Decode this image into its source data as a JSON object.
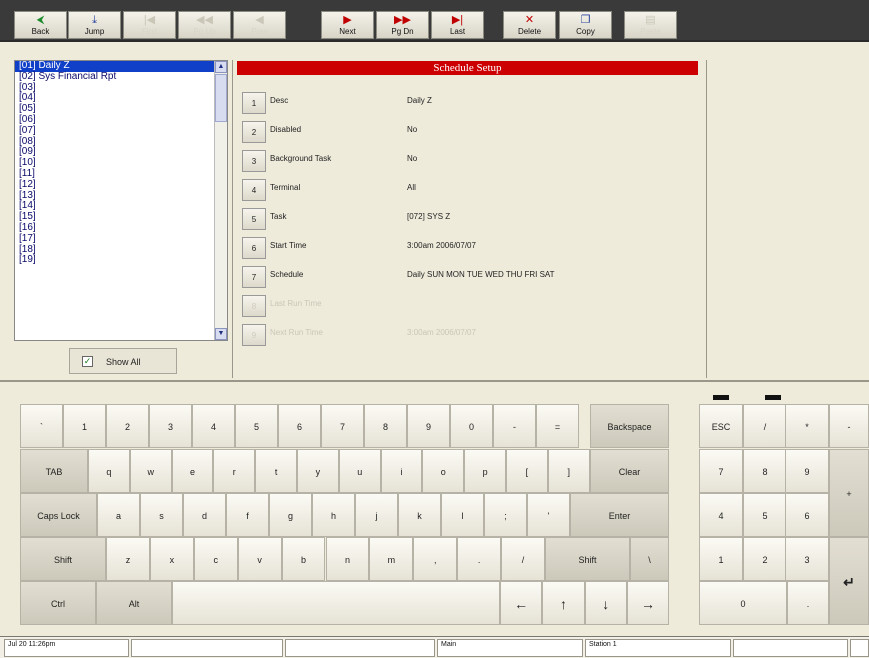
{
  "toolbar": {
    "buttons": [
      {
        "label": "Back",
        "icon": "back-arrow-icon",
        "glyph": "⮜",
        "enabled": true
      },
      {
        "label": "Jump",
        "icon": "jump-icon",
        "glyph": "⤓",
        "enabled": true
      },
      {
        "label": "First",
        "icon": "first-icon",
        "glyph": "|◀",
        "enabled": false
      },
      {
        "label": "Pg Up",
        "icon": "page-up-icon",
        "glyph": "◀◀",
        "enabled": false
      },
      {
        "label": "Prev",
        "icon": "prev-icon",
        "glyph": "◀",
        "enabled": false
      },
      {
        "label": "Next",
        "icon": "next-icon",
        "glyph": "▶",
        "enabled": true
      },
      {
        "label": "Pg Dn",
        "icon": "page-down-icon",
        "glyph": "▶▶",
        "enabled": true
      },
      {
        "label": "Last",
        "icon": "last-icon",
        "glyph": "▶|",
        "enabled": true
      },
      {
        "label": "Delete",
        "icon": "delete-icon",
        "glyph": "✕",
        "enabled": true
      },
      {
        "label": "Copy",
        "icon": "copy-icon",
        "glyph": "❐",
        "enabled": true
      },
      {
        "label": "Paste",
        "icon": "paste-icon",
        "glyph": "▤",
        "enabled": false
      }
    ]
  },
  "list": {
    "items": [
      "[01] Daily Z",
      "[02] Sys Financial Rpt",
      "[03]",
      "[04]",
      "[05]",
      "[06]",
      "[07]",
      "[08]",
      "[09]",
      "[10]",
      "[11]",
      "[12]",
      "[13]",
      "[14]",
      "[15]",
      "[16]",
      "[17]",
      "[18]",
      "[19]"
    ],
    "selected_index": 0,
    "show_all_label": "Show All",
    "show_all_checked": "✓"
  },
  "setup": {
    "title": "Schedule Setup",
    "rows": [
      {
        "num": "1",
        "label": "Desc",
        "value": "Daily Z",
        "enabled": true
      },
      {
        "num": "2",
        "label": "Disabled",
        "value": "No",
        "enabled": true
      },
      {
        "num": "3",
        "label": "Background Task",
        "value": "No",
        "enabled": true
      },
      {
        "num": "4",
        "label": "Terminal",
        "value": "All",
        "enabled": true
      },
      {
        "num": "5",
        "label": "Task",
        "value": "[072] SYS Z",
        "enabled": true
      },
      {
        "num": "6",
        "label": "Start Time",
        "value": " 3:00am 2006/07/07",
        "enabled": true
      },
      {
        "num": "7",
        "label": "Schedule",
        "value": "Daily SUN MON TUE WED THU FRI SAT",
        "enabled": true
      },
      {
        "num": "8",
        "label": "Last Run Time",
        "value": "",
        "enabled": false
      },
      {
        "num": "9",
        "label": "Next Run Time",
        "value": " 3:00am 2006/07/07",
        "enabled": false
      }
    ]
  },
  "keyboard": {
    "row1": [
      "`",
      "1",
      "2",
      "3",
      "4",
      "5",
      "6",
      "7",
      "8",
      "9",
      "0",
      "-",
      "=",
      "Backspace"
    ],
    "row2": [
      "TAB",
      "q",
      "w",
      "e",
      "r",
      "t",
      "y",
      "u",
      "i",
      "o",
      "p",
      "[",
      "]",
      "Clear"
    ],
    "row3": [
      "Caps Lock",
      "a",
      "s",
      "d",
      "f",
      "g",
      "h",
      "j",
      "k",
      "l",
      ";",
      "'",
      "Enter"
    ],
    "row4": [
      "Shift",
      "z",
      "x",
      "c",
      "v",
      "b",
      "n",
      "m",
      ",",
      ".",
      "/",
      "Shift",
      "\\"
    ],
    "row5": [
      "Ctrl",
      "Alt",
      "",
      "←",
      "↑",
      "↓",
      "→"
    ]
  },
  "keypad": {
    "top": [
      "ESC",
      "/",
      "*",
      "-"
    ],
    "r1": [
      "7",
      "8",
      "9"
    ],
    "r2": [
      "4",
      "5",
      "6"
    ],
    "r3": [
      "1",
      "2",
      "3"
    ],
    "r4": [
      "0",
      "."
    ],
    "plus": "+",
    "enter_glyph": "↵"
  },
  "status": {
    "datetime": "Jul 20 11:26pm",
    "c2": "",
    "c3": "",
    "section": "Main",
    "station": "Station 1",
    "c6": "",
    "c7": ""
  }
}
